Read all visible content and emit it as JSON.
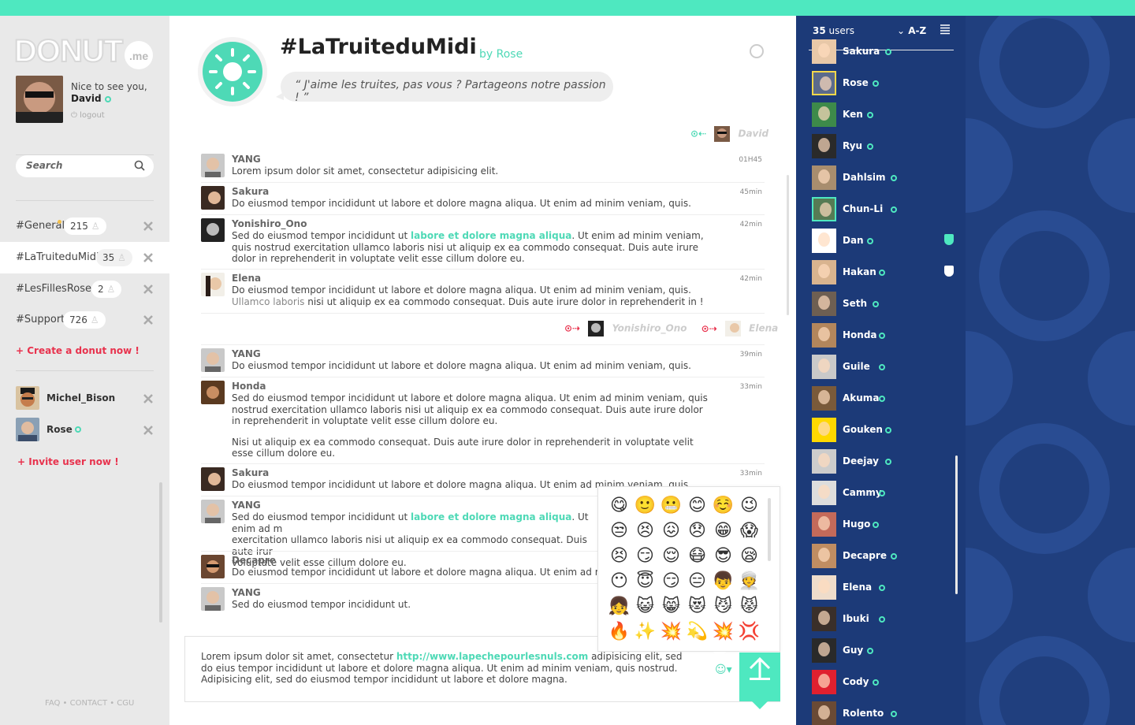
{
  "colors": {
    "accent": "#4ee8c0",
    "danger": "#e8324d",
    "panel": "#1c3a78"
  },
  "logo": {
    "text": "DONUT",
    "suffix": ".me"
  },
  "me": {
    "greeting": "Nice to see you,",
    "name": "David",
    "logout": "logout"
  },
  "search": {
    "placeholder": "Search"
  },
  "channels": [
    {
      "name": "#General",
      "count": "215"
    },
    {
      "name": "#LaTruiteduMidi",
      "count": "35"
    },
    {
      "name": "#LesFillesRoses",
      "count": "2"
    },
    {
      "name": "#Support",
      "count": "726"
    }
  ],
  "create_link": "+ Create a donut now !",
  "dms": [
    {
      "name": "Michel_Bison"
    },
    {
      "name": "Rose"
    }
  ],
  "invite_link": "+ Invite user now !",
  "footer": "FAQ • CONTACT • CGU",
  "channel": {
    "title": "#LaTruiteduMidi",
    "by": "by",
    "owner": "Rose",
    "quote": "“ J'aime les truites, pas vous ? Partageons notre passion ! ”"
  },
  "read": {
    "top": "David",
    "mid1": "Yonishiro_Ono",
    "mid2": "Elena"
  },
  "messages": [
    {
      "name": "YANG",
      "time": "01H45",
      "text": "Lorem ipsum dolor sit amet, consectetur adipisicing elit."
    },
    {
      "name": "Sakura",
      "time": "45min",
      "text": "Do eiusmod tempor incididunt ut labore et dolore magna aliqua. Ut enim ad minim veniam, quis."
    },
    {
      "name": "Yonishiro_Ono",
      "time": "42min",
      "pre": "Sed do eiusmod tempor incididunt ut ",
      "hl": "labore et dolore magna aliqua",
      "post": ". Ut enim ad minim veniam, quis nostrud exercitation ullamco laboris nisi ut aliquip ex ea commodo consequat. Duis aute irure dolor in reprehenderit in voluptate velit esse cillum dolore eu."
    },
    {
      "name": "Elena",
      "time": "42min",
      "pre": "Do eiusmod tempor incididunt ut labore et dolore magna aliqua. Ut enim ad minim veniam, quis. ",
      "muted": "Ullamco laboris",
      "post": " nisi ut aliquip ex ea commodo consequat. Duis aute irure dolor in reprehenderit in !"
    },
    {
      "name": "YANG",
      "time": "39min",
      "text": "Do eiusmod tempor incididunt ut labore et dolore magna aliqua. Ut enim ad minim veniam, quis."
    },
    {
      "name": "Honda",
      "time": "33min",
      "text": "Sed do eiusmod tempor incididunt ut labore et dolore magna aliqua. Ut enim ad minim veniam, quis nostrud exercitation ullamco laboris nisi ut aliquip ex ea commodo consequat. Duis aute irure dolor in reprehenderit in voluptate velit esse cillum dolore eu.",
      "text2": "Nisi ut aliquip ex ea commodo consequat. Duis aute irure dolor in reprehenderit in voluptate velit esse cillum dolore eu."
    },
    {
      "name": "Sakura",
      "time": "33min",
      "text": "Do eiusmod tempor incididunt ut labore et dolore magna aliqua. Ut enim ad minim veniam, quis."
    },
    {
      "name": "YANG",
      "time": "",
      "pre": "Sed do eiusmod tempor incididunt ut ",
      "hl": "labore et dolore magna aliqua",
      "post": ". Ut enim ad m",
      "line2": "exercitation ullamco laboris nisi ut aliquip ex ea commodo consequat. Duis aute irur",
      "line3": "voluptate velit esse cillum dolore eu."
    },
    {
      "name": "Decapre",
      "time": "",
      "text": "Do eiusmod tempor incididunt ut labore et dolore magna aliqua. Ut enim ad minim v"
    },
    {
      "name": "YANG",
      "time": "",
      "text": "Sed do eiusmod tempor incididunt ut."
    }
  ],
  "input": {
    "pre": "Lorem ipsum dolor sit amet, consectetur ",
    "link": "http://www.lapechepourlesnuls.com",
    "post": " adipisicing elit, sed do eius tempor incididunt ut labore et dolore magna aliqua. Ut enim ad minim veniam, quis nostrud. Adipisicing elit, sed do eiusmod tempor incididunt ut labore et dolore magna."
  },
  "emojis": [
    "😋",
    "🙂",
    "😬",
    "😊",
    "☺️",
    "😉",
    "😒",
    "😣",
    "😖",
    "😞",
    "😁",
    "😱",
    "😣",
    "😏",
    "😌",
    "😷",
    "😎",
    "😪",
    "😶",
    "😇",
    "😏",
    "😑",
    "👦",
    "👳",
    "👧",
    "😺",
    "😸",
    "😻",
    "😼",
    "😾",
    "🔥",
    "✨",
    "💥",
    "💫",
    "💥",
    "💢"
  ],
  "users": {
    "count": "35",
    "label": "users",
    "sort": "A-Z",
    "list": [
      "Sakura",
      "Rose",
      "Ken",
      "Ryu",
      "Dahlsim",
      "Chun-Li",
      "Dan",
      "Hakan",
      "Seth",
      "Honda",
      "Guile",
      "Akuma",
      "Gouken",
      "Deejay",
      "Cammy",
      "Hugo",
      "Decapre",
      "Elena",
      "Ibuki",
      "Guy",
      "Cody",
      "Rolento"
    ]
  }
}
